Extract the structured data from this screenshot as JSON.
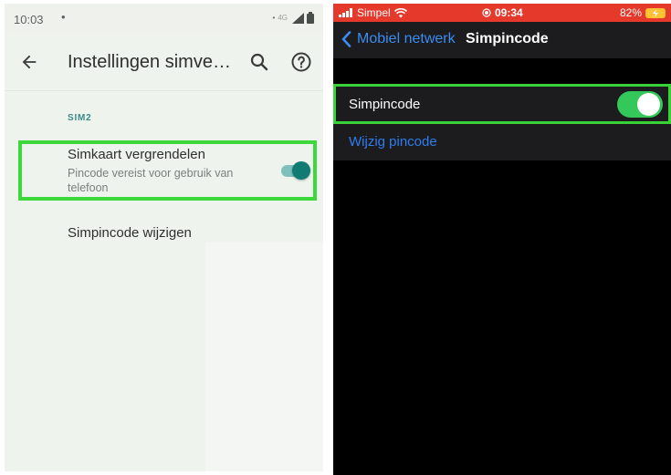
{
  "android": {
    "status": {
      "time": "10:03",
      "dot": "•",
      "net": "4G"
    },
    "appbar": {
      "title": "Instellingen simvergrendeling",
      "back_icon": "arrow-left-icon",
      "search_icon": "search-icon",
      "help_icon": "help-circle-icon"
    },
    "section_header": "SIM2",
    "lock_pref": {
      "title": "Simkaart vergrendelen",
      "summary": "Pincode vereist voor gebruik van telefoon",
      "enabled": true
    },
    "change_pref": {
      "title": "Simpincode wijzigen"
    },
    "colors": {
      "accent": "#117a72",
      "highlight": "#3cd83c",
      "background": "#eef3ee"
    }
  },
  "ios": {
    "status": {
      "carrier": "Simpel",
      "time": "09:34",
      "battery": "82%"
    },
    "nav": {
      "back_label": "Mobiel netwerk",
      "title": "Simpincode"
    },
    "toggle_row": {
      "label": "Simpincode",
      "enabled": true
    },
    "change_row": {
      "label": "Wijzig pincode"
    },
    "colors": {
      "statusbar": "#e5392c",
      "link": "#2f7df0",
      "switch_on": "#34c759",
      "highlight": "#38d238"
    }
  }
}
